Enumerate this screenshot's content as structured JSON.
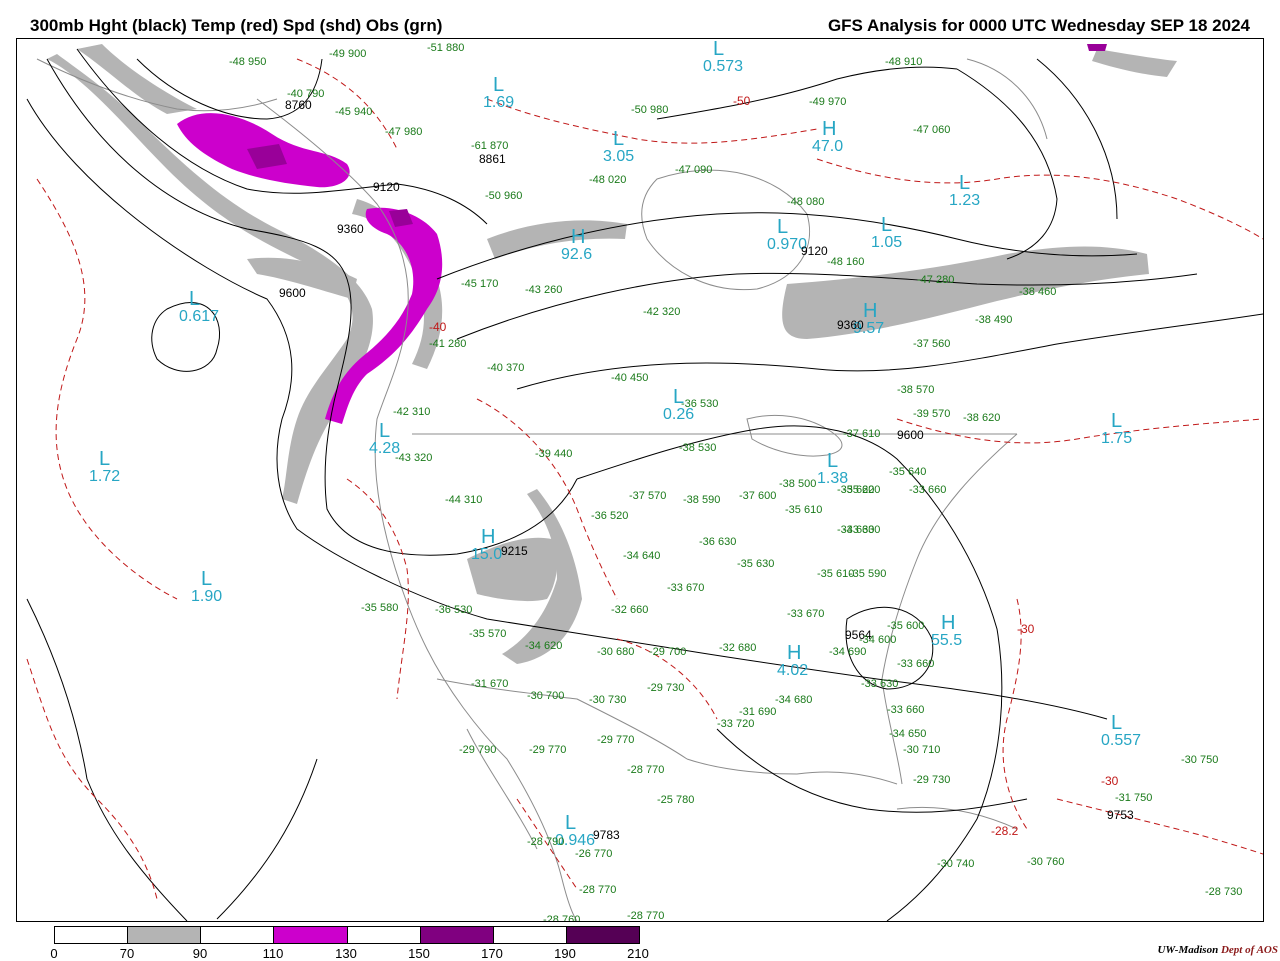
{
  "header": {
    "title": "300mb Hght (black) Temp (red) Spd (shd) Obs (grn)",
    "analysis": "GFS Analysis for 0000 UTC Wednesday SEP 18 2024"
  },
  "colors": {
    "height_contour": "#000000",
    "temperature_contour": "#c01818",
    "observation": "#1a7a1a",
    "pressure_system": "#27a6c4",
    "borders": "#8c8c8c",
    "speed_70_90": "#b4b4b4",
    "speed_110_130": "#cc00cc",
    "speed_130_150": "#990099",
    "speed_150_170": "#800080",
    "speed_190_210": "#550055"
  },
  "pressure_systems": [
    {
      "type": "L",
      "value": "1.69"
    },
    {
      "type": "L",
      "value": "0.573"
    },
    {
      "type": "L",
      "value": "0.617"
    },
    {
      "type": "L",
      "value": "1.72"
    },
    {
      "type": "L",
      "value": "1.90"
    },
    {
      "type": "H",
      "value": "47.0"
    },
    {
      "type": "L",
      "value": "1.23"
    },
    {
      "type": "L",
      "value": "1.05"
    },
    {
      "type": "L",
      "value": "0.970"
    },
    {
      "type": "H",
      "value": "92.6"
    },
    {
      "type": "L",
      "value": "3.05"
    },
    {
      "type": "L",
      "value": "0.26"
    },
    {
      "type": "L",
      "value": "1.75"
    },
    {
      "type": "H",
      "value": "55.5"
    },
    {
      "type": "L",
      "value": "0.557"
    },
    {
      "type": "L",
      "value": "0.946"
    },
    {
      "type": "L",
      "value": "4.28"
    },
    {
      "type": "H",
      "value": "15.0"
    },
    {
      "type": "H",
      "value": "9.57"
    },
    {
      "type": "H",
      "value": "4.02"
    },
    {
      "type": "L",
      "value": "1.38"
    }
  ],
  "height_labels": [
    "8760",
    "8861",
    "9120",
    "9360",
    "9600",
    "9120",
    "9360",
    "9600",
    "9564",
    "9783",
    "9753",
    "9215"
  ],
  "temperature_labels": [
    "-50",
    "-40",
    "-30",
    "-30",
    "-28.2"
  ],
  "observations": [
    "-48 950",
    "-49 900",
    "-51 880",
    "-40 790",
    "-45 940",
    "-47 980",
    "-61 870",
    "-50 960",
    "-48 020",
    "-47 090",
    "-50 980",
    "-48 080",
    "-48 160",
    "-49 970",
    "-48 910",
    "-47 060",
    "-47 280",
    "-38 460",
    "-41 280",
    "-43 260",
    "-45 170",
    "-42 320",
    "-40 370",
    "-40 450",
    "-36 530",
    "-38 530",
    "-39 440",
    "-42 310",
    "-43 320",
    "-44 310",
    "-37 570",
    "-36 520",
    "-38 590",
    "-37 600",
    "-35 610",
    "-37 610",
    "-33 630",
    "-38 500",
    "-35 640",
    "-35 620",
    "-33 660",
    "-34 630",
    "-36 630",
    "-35 630",
    "-34 640",
    "-33 670",
    "-32 660",
    "-35 580",
    "-36 530",
    "-35 570",
    "-34 620",
    "-30 680",
    "-29 700",
    "-32 680",
    "-33 670",
    "-35 610",
    "-35 590",
    "-34 690",
    "-34 600",
    "-33 630",
    "-31 670",
    "-30 700",
    "-30 730",
    "-29 730",
    "-29 790",
    "-29 770",
    "-29 770",
    "-28 770",
    "-25 780",
    "-33 720",
    "-31 690",
    "-33 660",
    "-34 650",
    "-30 710",
    "-29 730",
    "-30 750",
    "-31 750",
    "-28 790",
    "-26 770",
    "-28 770",
    "-28 760",
    "-28 770",
    "-30 740",
    "-30 760",
    "-28 730",
    "-38 570",
    "-35 620",
    "-39 570",
    "-38 620",
    "-37 560",
    "-38 490",
    "-35 600",
    "-34 680",
    "-33 660"
  ],
  "legend": {
    "ticks": [
      "0",
      "70",
      "90",
      "110",
      "130",
      "150",
      "170",
      "190",
      "210"
    ]
  },
  "credit": {
    "org": "UW-Madison",
    "dept": "Dept of AOS"
  }
}
